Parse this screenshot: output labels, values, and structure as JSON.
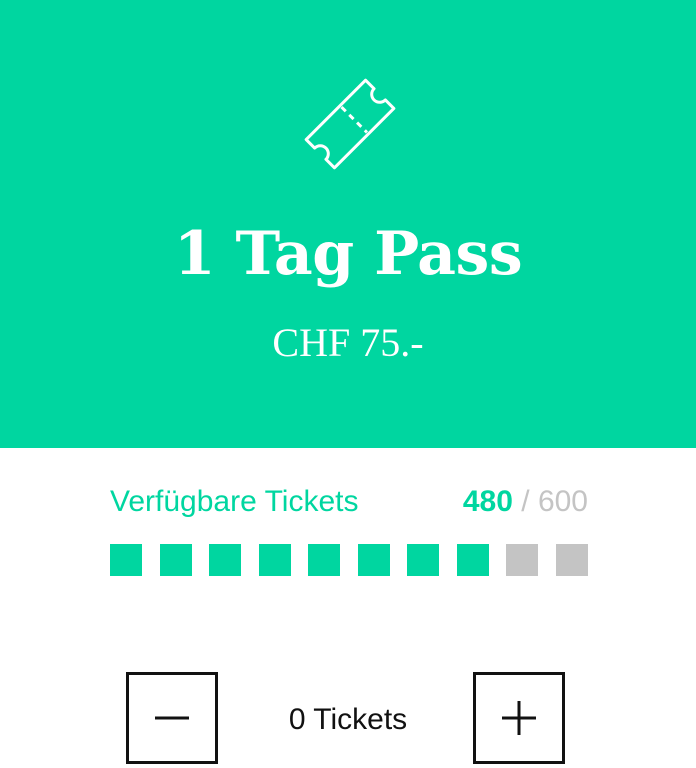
{
  "pass": {
    "icon": "ticket-icon",
    "title": "1 Tag Pass",
    "price": "CHF 75.-"
  },
  "availability": {
    "label": "Verfügbare Tickets",
    "available": "480",
    "separator": "/",
    "total": "600",
    "fraction_available": 0.8
  },
  "stepper": {
    "minus_icon": "minus-icon",
    "plus_icon": "plus-icon",
    "quantity_label": "0 Tickets"
  },
  "colors": {
    "accent": "#00d6a0",
    "inactive": "#c4c4c4",
    "text": "#111111"
  }
}
